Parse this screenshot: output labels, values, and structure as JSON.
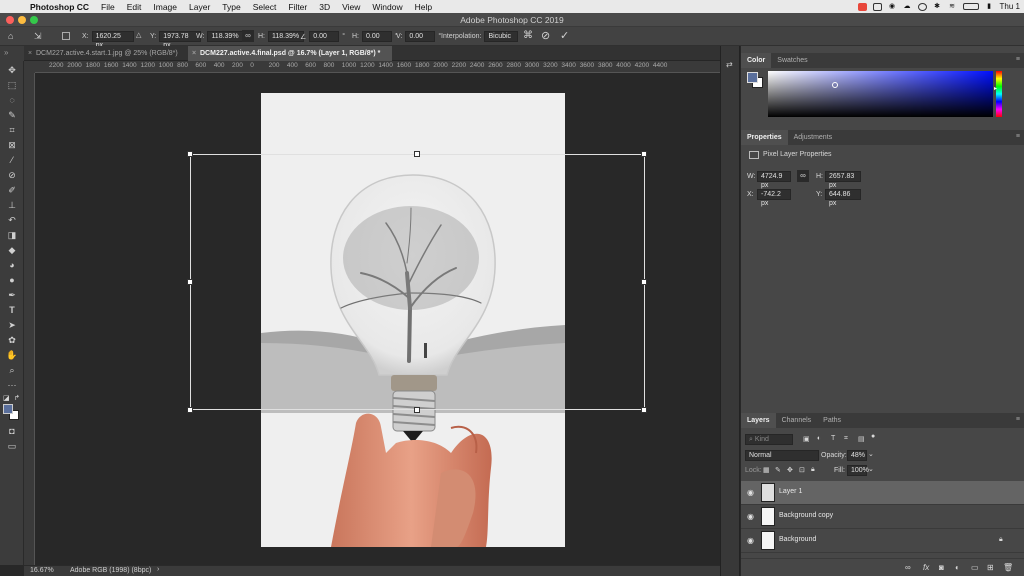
{
  "menubar": {
    "app_name": "Photoshop CC",
    "items": [
      "File",
      "Edit",
      "Image",
      "Layer",
      "Type",
      "Select",
      "Filter",
      "3D",
      "View",
      "Window",
      "Help"
    ],
    "clock": "Thu 1"
  },
  "window": {
    "title": "Adobe Photoshop CC 2019"
  },
  "options": {
    "x_label": "X:",
    "x_value": "1620.25 px",
    "y_label": "Y:",
    "y_value": "1973.78 px",
    "w_label": "W:",
    "w_value": "118.39%",
    "h_label": "H:",
    "h_value": "118.39%",
    "rot_value": "0.00",
    "hskew_label": "H:",
    "hskew_value": "0.00",
    "vskew_label": "V:",
    "vskew_value": "0.00",
    "interp_label": "Interpolation:",
    "interp_value": "Bicubic"
  },
  "tabs": [
    {
      "label": "DCM227.active.4.start.1.jpg @ 25% (RGB/8*)",
      "active": false
    },
    {
      "label": "DCM227.active.4.final.psd @ 16.7% (Layer 1, RGB/8*) *",
      "active": true
    }
  ],
  "ruler_ticks": [
    "2200",
    "2000",
    "1800",
    "1600",
    "1400",
    "1200",
    "1000",
    "800",
    "600",
    "400",
    "200",
    "0",
    "200",
    "400",
    "600",
    "800",
    "1000",
    "1200",
    "1400",
    "1600",
    "1800",
    "2000",
    "2200",
    "2400",
    "2600",
    "2800",
    "3000",
    "3200",
    "3400",
    "3600",
    "3800",
    "4000",
    "4200",
    "4400"
  ],
  "status": {
    "zoom": "16.67%",
    "profile": "Adobe RGB (1998) (8bpc)"
  },
  "color_panel": {
    "tabs": [
      "Color",
      "Swatches"
    ]
  },
  "properties_panel": {
    "tabs": [
      "Properties",
      "Adjustments"
    ],
    "header": "Pixel Layer Properties",
    "w_label": "W:",
    "w_value": "4724.9 px",
    "h_label": "H:",
    "h_value": "2657.83 px",
    "x_label": "X:",
    "x_value": "-742.2 px",
    "y_label": "Y:",
    "y_value": "644.86 px"
  },
  "layers_panel": {
    "tabs": [
      "Layers",
      "Channels",
      "Paths"
    ],
    "filter_placeholder": "Kind",
    "blend_mode": "Normal",
    "opacity_label": "Opacity:",
    "opacity_value": "48%",
    "lock_label": "Lock:",
    "fill_label": "Fill:",
    "fill_value": "100%",
    "layers": [
      {
        "name": "Layer 1",
        "selected": true,
        "locked": false
      },
      {
        "name": "Background copy",
        "selected": false,
        "locked": false
      },
      {
        "name": "Background",
        "selected": false,
        "locked": true
      }
    ]
  },
  "colors": {
    "accent": "#4a6fa5",
    "foreground_swatch": "#5a6f9c",
    "hue_blue": "#0000ff"
  }
}
